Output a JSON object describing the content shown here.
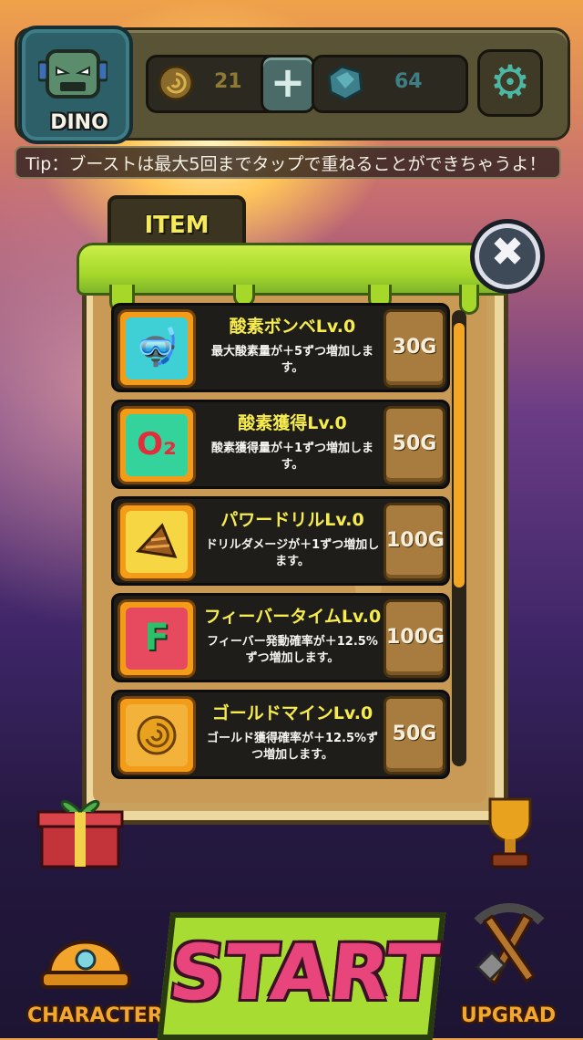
{
  "header": {
    "character_name": "DINO",
    "coins": "21",
    "gems": "64",
    "add_label": "+",
    "settings_icon": "gear-icon"
  },
  "tip": "Tip：ブーストは最大5回までタップで重ねることができちゃうよ！",
  "panel": {
    "tab_label": "ITEM",
    "close_label": "✖"
  },
  "items": [
    {
      "title": "酸素ボンベLv.0",
      "desc": "最大酸素量が＋5ずつ増加します。",
      "price": "30G",
      "icon": "oxygen-tank-icon",
      "color": "#3fd0d6"
    },
    {
      "title": "酸素獲得Lv.0",
      "desc": "酸素獲得量が＋1ずつ増加します。",
      "price": "50G",
      "icon": "o2-icon",
      "color": "#35d39c"
    },
    {
      "title": "パワードリルLv.0",
      "desc": "ドリルダメージが＋1ずつ増加します。",
      "price": "100G",
      "icon": "drill-icon",
      "color": "#f6d743"
    },
    {
      "title": "フィーバータイムLv.0",
      "desc": "フィーバー発動確率が＋12.5%ずつ増加します。",
      "price": "100G",
      "icon": "fever-icon",
      "color": "#e74a5e"
    },
    {
      "title": "ゴールドマインLv.0",
      "desc": "ゴールド獲得確率が＋12.5%ずつ増加します。",
      "price": "50G",
      "icon": "gold-coin-icon",
      "color": "#f3b33a"
    }
  ],
  "bottom": {
    "character_label": "CHARACTER",
    "start_label": "START",
    "upgrade_label": "UPGRAD"
  }
}
